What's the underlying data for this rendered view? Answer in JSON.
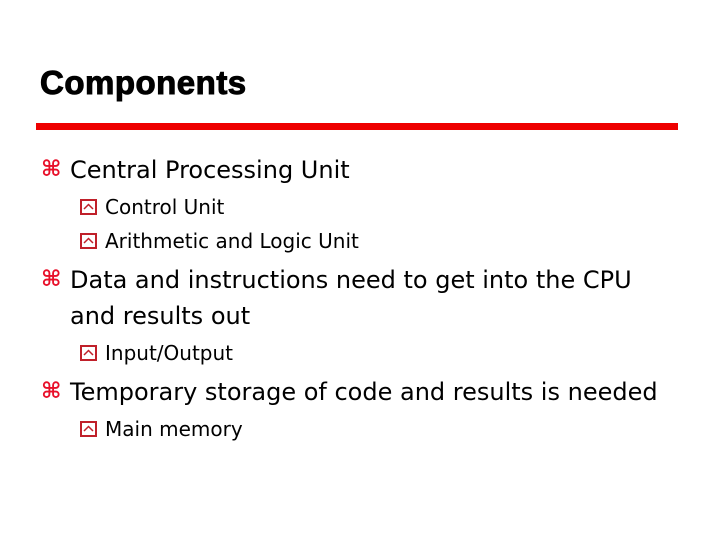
{
  "slide": {
    "title": "Components",
    "accent_color": "#ee0000",
    "bullet_color": "#e8102a",
    "bullets": [
      {
        "text": "Central Processing Unit",
        "icon": "command-key-icon",
        "sub": [
          {
            "text": "Control Unit",
            "icon": "boxed-chevron-up-icon"
          },
          {
            "text": "Arithmetic and Logic Unit",
            "icon": "boxed-chevron-up-icon"
          }
        ]
      },
      {
        "text": "Data and instructions need to get into the CPU and results out",
        "icon": "command-key-icon",
        "sub": [
          {
            "text": "Input/Output",
            "icon": "boxed-chevron-up-icon"
          }
        ]
      },
      {
        "text": "Temporary storage of code and results is needed",
        "icon": "command-key-icon",
        "sub": [
          {
            "text": "Main memory",
            "icon": "boxed-chevron-up-icon"
          }
        ]
      }
    ]
  }
}
